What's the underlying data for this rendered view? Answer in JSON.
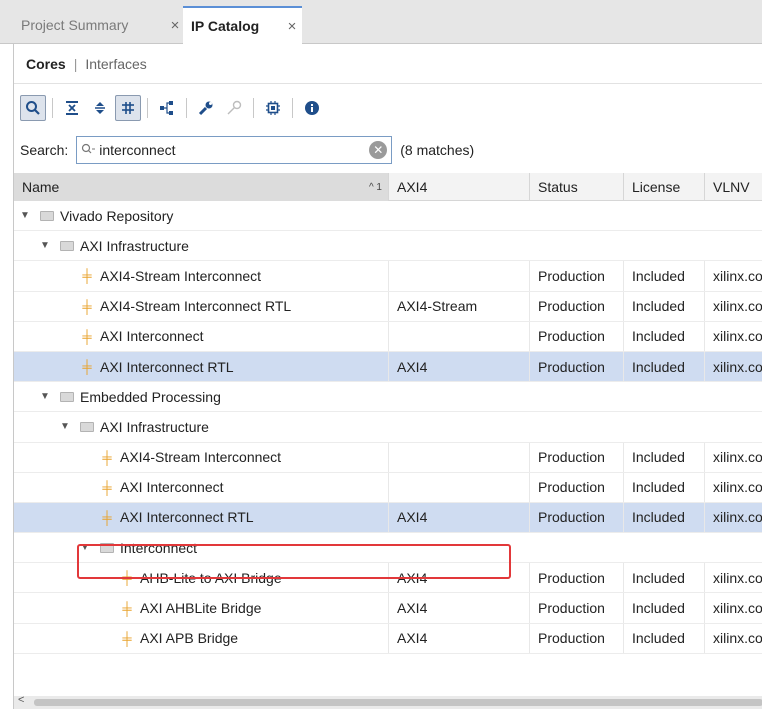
{
  "tabs": [
    {
      "label": "Project Summary",
      "close": "×"
    },
    {
      "label": "IP Catalog",
      "close": "×"
    }
  ],
  "subtabs": {
    "cores": "Cores",
    "separator": "|",
    "interfaces": "Interfaces"
  },
  "toolbar": {
    "icons": [
      "search-icon",
      "collapse-all-icon",
      "expand-all-icon",
      "filter-toggle-icon",
      "hierarchy-icon",
      "settings-wrench-icon",
      "key-icon",
      "chip-icon",
      "info-icon"
    ]
  },
  "search": {
    "label": "Search:",
    "value": "interconnect",
    "placeholder": "",
    "matches": "(8 matches)"
  },
  "columns": {
    "name": "Name",
    "sort": "^ 1",
    "axi4": "AXI4",
    "status": "Status",
    "license": "License",
    "vlnv": "VLNV"
  },
  "rows": [
    {
      "type": "group",
      "name": "Vivado Repository"
    },
    {
      "type": "group",
      "name": "AXI Infrastructure"
    },
    {
      "type": "core",
      "name": "AXI4-Stream Interconnect",
      "axi4": "",
      "status": "Production",
      "license": "Included",
      "vlnv": "xilinx.co"
    },
    {
      "type": "core",
      "name": "AXI4-Stream Interconnect RTL",
      "axi4": "AXI4-Stream",
      "status": "Production",
      "license": "Included",
      "vlnv": "xilinx.co"
    },
    {
      "type": "core",
      "name": "AXI Interconnect",
      "axi4": "",
      "status": "Production",
      "license": "Included",
      "vlnv": "xilinx.co"
    },
    {
      "type": "core",
      "name": "AXI Interconnect RTL",
      "axi4": "AXI4",
      "status": "Production",
      "license": "Included",
      "vlnv": "xilinx.co"
    },
    {
      "type": "group",
      "name": "Embedded Processing"
    },
    {
      "type": "group",
      "name": "AXI Infrastructure"
    },
    {
      "type": "core",
      "name": "AXI4-Stream Interconnect",
      "axi4": "",
      "status": "Production",
      "license": "Included",
      "vlnv": "xilinx.co"
    },
    {
      "type": "core",
      "name": "AXI Interconnect",
      "axi4": "",
      "status": "Production",
      "license": "Included",
      "vlnv": "xilinx.co"
    },
    {
      "type": "core",
      "name": "AXI Interconnect RTL",
      "axi4": "AXI4",
      "status": "Production",
      "license": "Included",
      "vlnv": "xilinx.co"
    },
    {
      "type": "group",
      "name": "Interconnect"
    },
    {
      "type": "core",
      "name": "AHB-Lite to AXI Bridge",
      "axi4": "AXI4",
      "status": "Production",
      "license": "Included",
      "vlnv": "xilinx.co"
    },
    {
      "type": "core",
      "name": "AXI AHBLite Bridge",
      "axi4": "AXI4",
      "status": "Production",
      "license": "Included",
      "vlnv": "xilinx.co"
    },
    {
      "type": "core",
      "name": "AXI APB Bridge",
      "axi4": "AXI4",
      "status": "Production",
      "license": "Included",
      "vlnv": "xilinx.co"
    }
  ],
  "colors": {
    "selected_row": "#cfdcf1",
    "highlight": "#e2383a",
    "core_icon": "#e8a22b",
    "accent": "#1f4e8a"
  }
}
